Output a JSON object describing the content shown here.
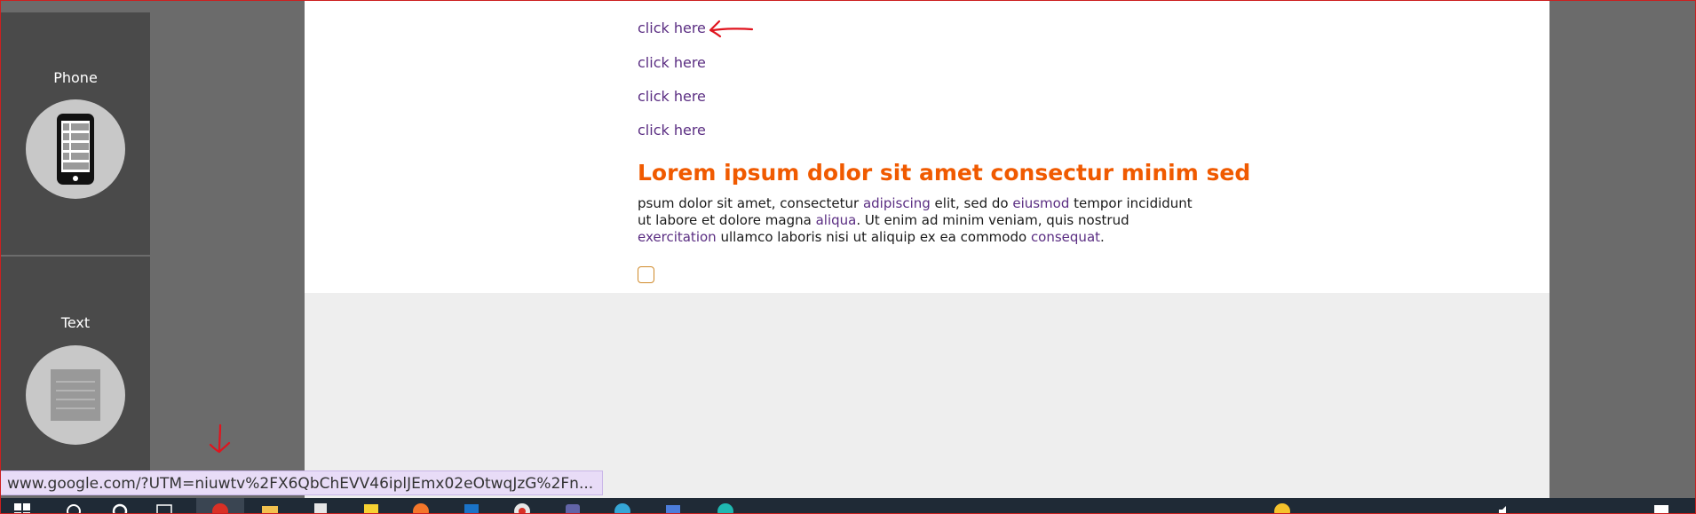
{
  "sidebar": {
    "items": [
      {
        "label": "Phone",
        "icon": "phone-icon"
      },
      {
        "label": "Text",
        "icon": "text-document-icon"
      }
    ]
  },
  "content": {
    "links": [
      "click here",
      "click here",
      "click here",
      "click here"
    ],
    "heading": "Lorem ipsum dolor sit amet consectur minim sed",
    "paragraph": [
      {
        "text": "psum dolor sit amet, consectetur ",
        "link": false
      },
      {
        "text": "adipiscing",
        "link": true
      },
      {
        "text": " elit, sed do ",
        "link": false
      },
      {
        "text": "eiusmod",
        "link": true
      },
      {
        "text": " tempor incididunt ut labore et dolore magna ",
        "link": false
      },
      {
        "text": "aliqua",
        "link": true
      },
      {
        "text": ". Ut enim ad minim veniam, quis nostrud ",
        "link": false
      },
      {
        "text": "exercitation",
        "link": true
      },
      {
        "text": " ullamco laboris nisi ut aliquip ex ea commodo ",
        "link": false
      },
      {
        "text": "consequat",
        "link": true
      },
      {
        "text": ".",
        "link": false
      }
    ],
    "checkbox_checked": false
  },
  "status_bar": {
    "url": "www.google.com/?UTM=niuwtv%2FX6QbChEVV46iplJEmx02eOtwqJzG%2Fn..."
  },
  "taskbar": {
    "icons": [
      "windows-start-icon",
      "search-icon",
      "cortana-icon",
      "task-view-icon",
      "chrome-icon",
      "file-explorer-icon",
      "notepad-icon",
      "sticky-notes-icon",
      "firefox-icon",
      "outlook-icon",
      "chrome-alt-icon",
      "teams-icon",
      "edge-icon",
      "store-icon",
      "browser-icon",
      "emoji-icon",
      "volume-icon",
      "notification-icon"
    ]
  },
  "colors": {
    "accent_heading": "#f05a00",
    "link": "#5a2d82",
    "sidebar_bg": "#4a4a4a",
    "page_bg": "#6b6b6b",
    "annotation": "#e0141e",
    "status_url_bg": "#e8dcf7"
  }
}
